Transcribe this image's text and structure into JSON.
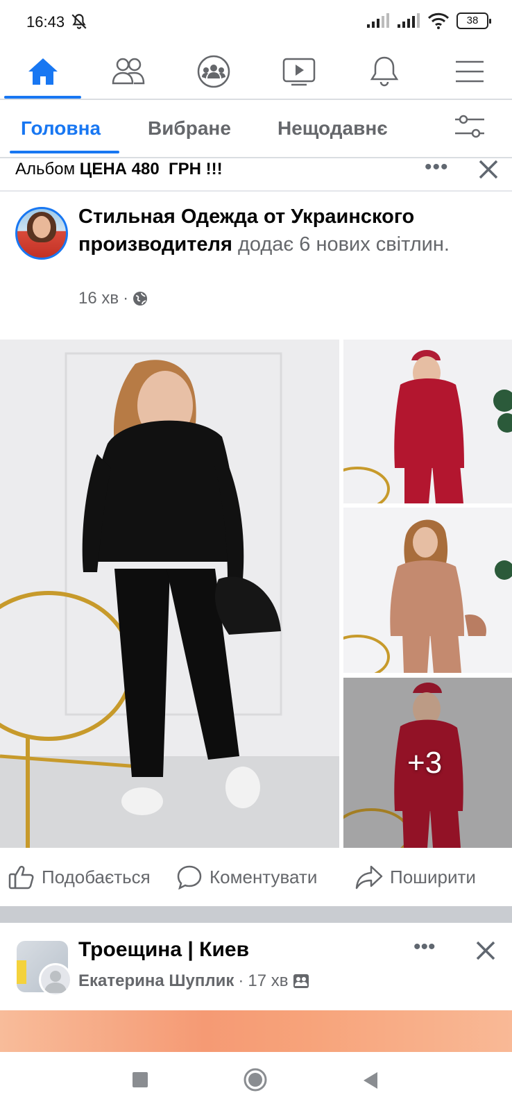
{
  "status_bar": {
    "time": "16:43",
    "battery": "38",
    "icons": [
      "bell-off-icon",
      "signal-icon",
      "signal-icon",
      "wifi-icon",
      "battery-icon"
    ]
  },
  "top_nav": {
    "items": [
      {
        "icon": "home-icon",
        "active": true
      },
      {
        "icon": "friends-icon",
        "active": false
      },
      {
        "icon": "groups-icon",
        "active": false
      },
      {
        "icon": "video-icon",
        "active": false
      },
      {
        "icon": "notifications-icon",
        "active": false
      },
      {
        "icon": "menu-icon",
        "active": false
      }
    ],
    "accent": "#1877f2"
  },
  "feed_tabs": {
    "tabs": [
      {
        "label": "Головна",
        "active": true
      },
      {
        "label": "Вибране",
        "active": false
      },
      {
        "label": "Нещодавнє",
        "active": false
      }
    ],
    "filter_icon": "filter-sliders-icon"
  },
  "album_strip": {
    "prefix": "Альбом",
    "title": "ЦЕНА 480  ГРН !!!"
  },
  "post": {
    "page_name": "Стильная Одежда от Украинского производителя",
    "action": "додає 6 нових світлин.",
    "time": "16 хв",
    "separator": "·",
    "audience_icon": "globe-icon",
    "more_photos": "+3"
  },
  "actions": {
    "like": "Подобається",
    "comment": "Коментувати",
    "share": "Поширити"
  },
  "post2": {
    "group_name": "Троещина | Киев",
    "author": "Екатерина Шуплик",
    "separator": "·",
    "time": "17 хв",
    "audience_icon": "group-members-icon"
  },
  "system_nav": [
    "recents-icon",
    "home-circle-icon",
    "back-icon"
  ]
}
